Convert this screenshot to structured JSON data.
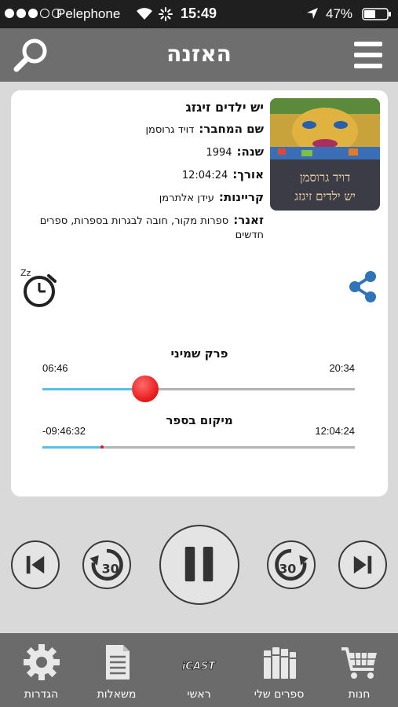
{
  "status_bar": {
    "carrier": "Pelephone",
    "time": "15:49",
    "battery": "47%"
  },
  "nav": {
    "title": "האזנה"
  },
  "book": {
    "cover_author": "דויד גרוסמן",
    "cover_title": "יש ילדים זיגזג",
    "title": "יש ילדים זיגזג",
    "author_label": "שם המחבר:",
    "author": "דויד גרוסמן",
    "year_label": "שנה:",
    "year": "1994",
    "length_label": "אורך:",
    "length": "12:04:24",
    "narrator_label": "קריינות:",
    "narrator": "עידן אלתרמן",
    "genre_label": "זאנר:",
    "genre": "ספרות מקור, חובה לבגרות בספרות, ספרים חדשים"
  },
  "player": {
    "chapter_name": "פרק שמיני",
    "chapter_elapsed": "06:46",
    "chapter_total": "20:34",
    "chapter_progress": 0.33,
    "book_position_label": "מיקום בספר",
    "book_remaining": "-09:46:32",
    "book_total": "12:04:24",
    "book_progress": 0.19,
    "skip_back_seconds": "30",
    "skip_forward_seconds": "30",
    "state": "playing"
  },
  "tabs": {
    "settings": "הגדרות",
    "quiz": "משאלות",
    "main": "ראשי",
    "main_logo": "iCAST",
    "my_books": "ספרים שלי",
    "store": "חנות"
  },
  "colors": {
    "accent_blue": "#56c1e6",
    "knob_red": "#e81515",
    "share_blue": "#2f73b8"
  }
}
